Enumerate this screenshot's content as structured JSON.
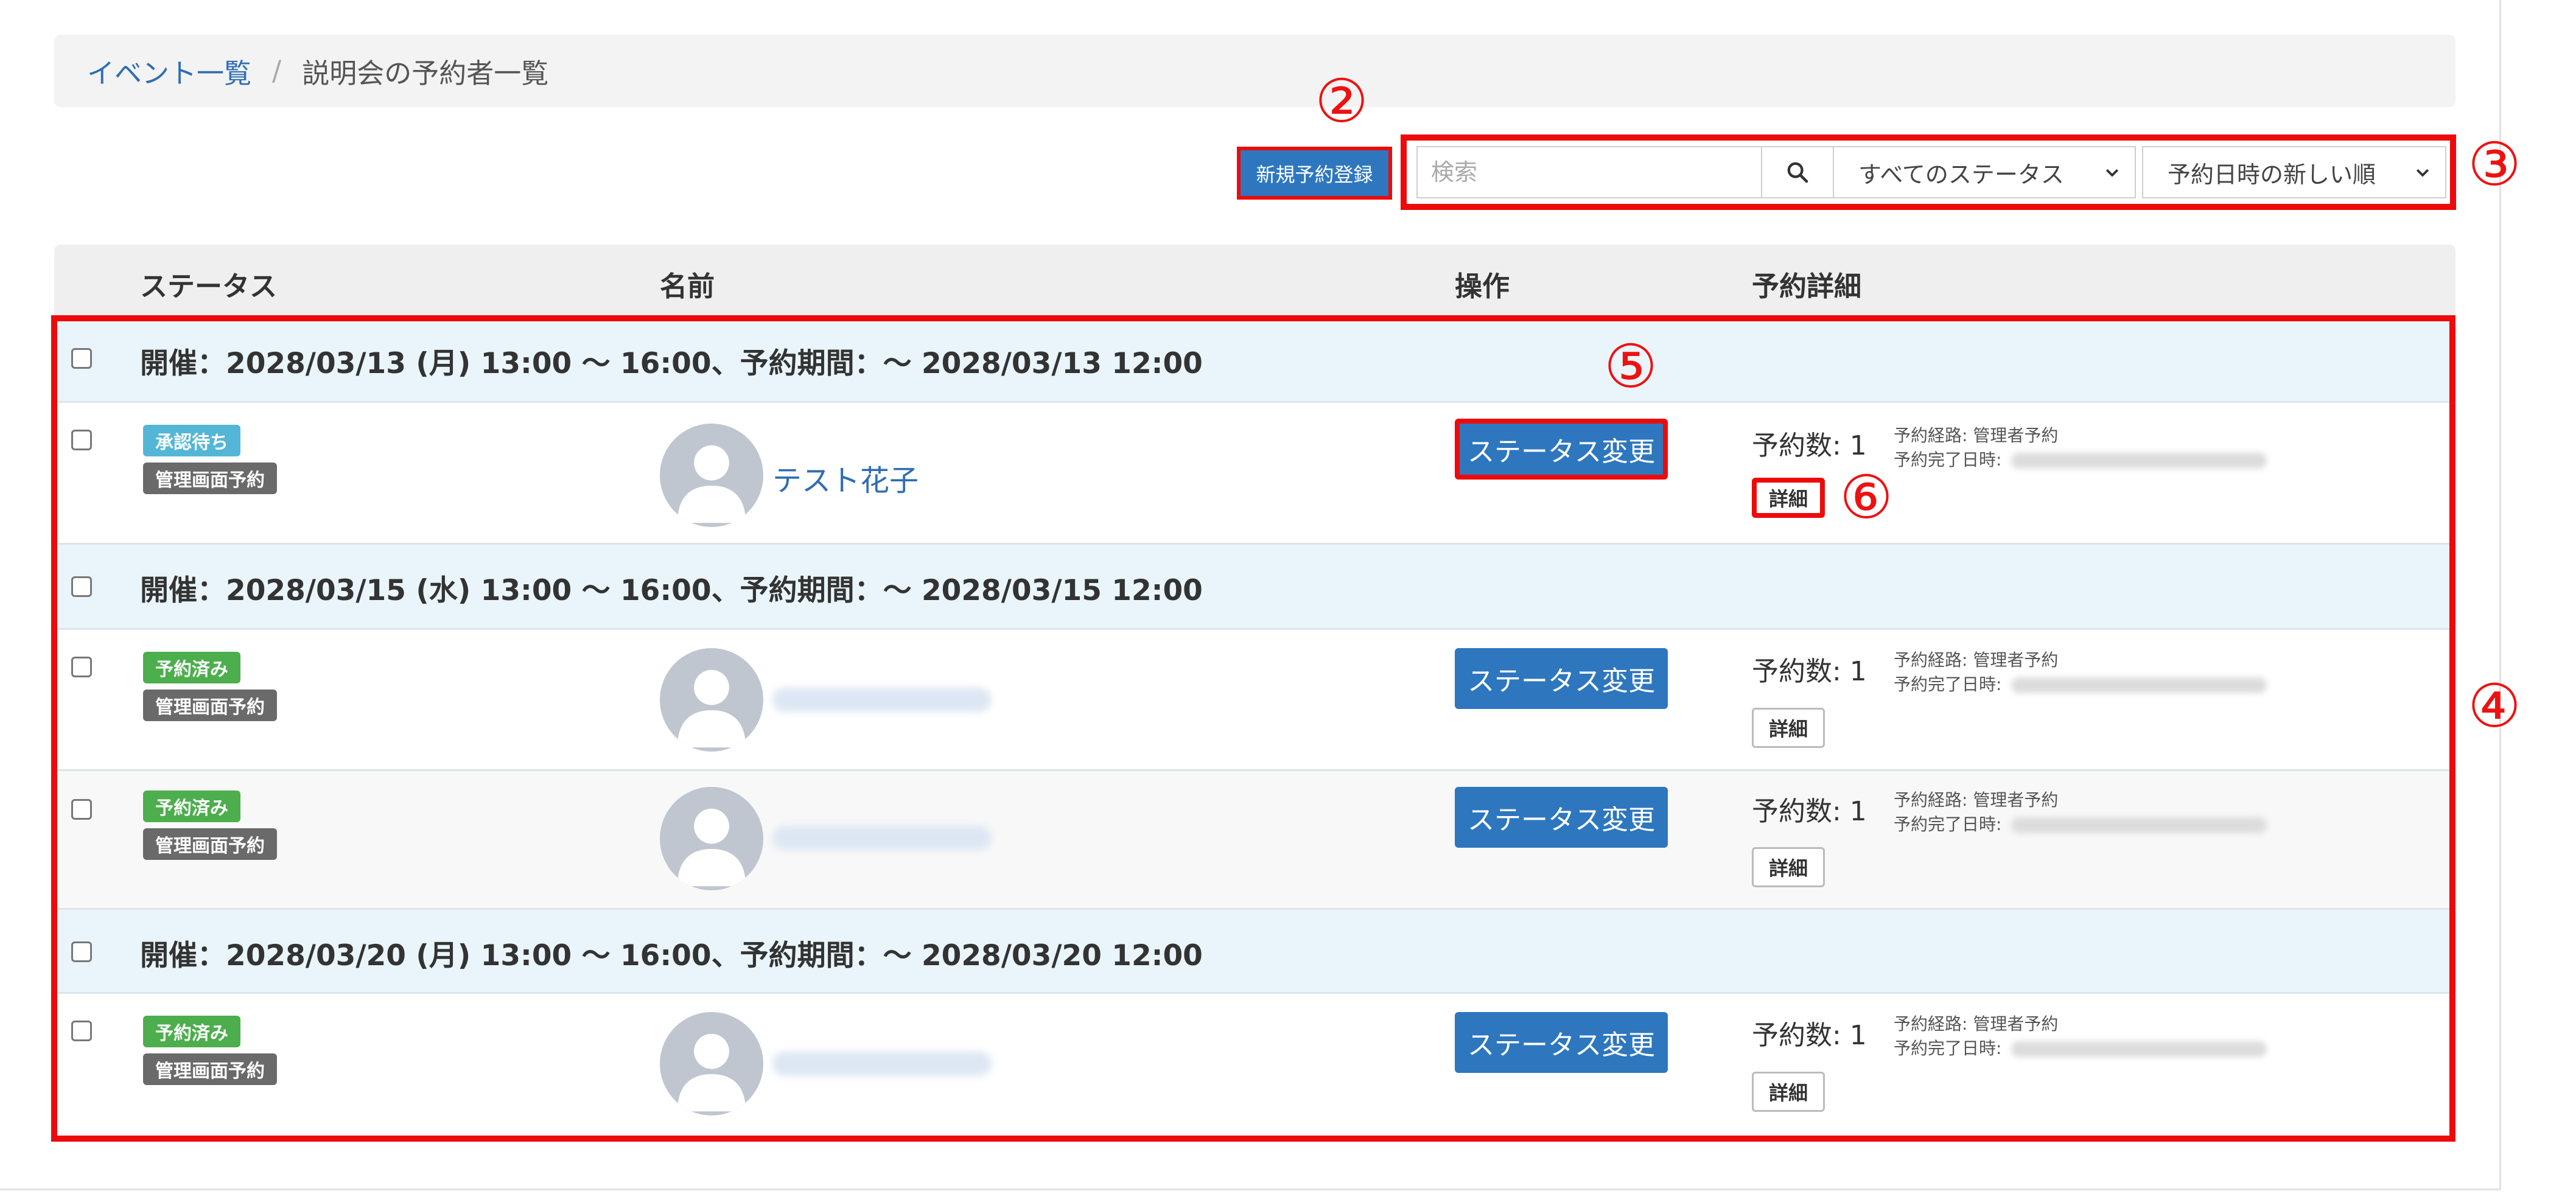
{
  "breadcrumb": {
    "parent": "イベント一覧",
    "separator": "/",
    "current": "説明会の予約者一覧"
  },
  "markers": {
    "m2": "②",
    "m3": "③",
    "m4": "④",
    "m5": "⑤",
    "m6": "⑥"
  },
  "toolbar": {
    "new_reservation_label": "新規予約登録",
    "search_placeholder": "検索",
    "status_filter": "すべてのステータス",
    "sort_order": "予約日時の新しい順"
  },
  "table": {
    "columns": {
      "status": "ステータス",
      "name": "名前",
      "action": "操作",
      "details": "予約詳細"
    },
    "groups": [
      {
        "title": "開催：2028/03/13 (月) 13:00 ～ 16:00、予約期間：～ 2028/03/13 12:00",
        "rows": [
          {
            "status": "承認待ち",
            "source_badge": "管理画面予約",
            "name": "テスト花子",
            "action": "ステータス変更",
            "count": "予約数: 1",
            "route": "予約経路: 管理者予約",
            "completed": "予約完了日時:",
            "detail": "詳細"
          }
        ]
      },
      {
        "title": "開催：2028/03/15 (水) 13:00 ～ 16:00、予約期間：～ 2028/03/15 12:00",
        "rows": [
          {
            "status": "予約済み",
            "source_badge": "管理画面予約",
            "name": "",
            "action": "ステータス変更",
            "count": "予約数: 1",
            "route": "予約経路: 管理者予約",
            "completed": "予約完了日時:",
            "detail": "詳細"
          },
          {
            "status": "予約済み",
            "source_badge": "管理画面予約",
            "name": "",
            "action": "ステータス変更",
            "count": "予約数: 1",
            "route": "予約経路: 管理者予約",
            "completed": "予約完了日時:",
            "detail": "詳細"
          }
        ]
      },
      {
        "title": "開催：2028/03/20 (月) 13:00 ～ 16:00、予約期間：～ 2028/03/20 12:00",
        "rows": [
          {
            "status": "予約済み",
            "source_badge": "管理画面予約",
            "name": "",
            "action": "ステータス変更",
            "count": "予約数: 1",
            "route": "予約経路: 管理者予約",
            "completed": "予約完了日時:",
            "detail": "詳細"
          }
        ]
      }
    ]
  },
  "colors": {
    "highlight_red": "#ee0a0a",
    "primary_blue": "#2e77bf",
    "link_blue": "#2f6db4",
    "pending_badge": "#53b6d6",
    "booked_badge": "#4cae4c",
    "admin_badge": "#6a6a6a",
    "group_bg": "#e9f5fa"
  }
}
